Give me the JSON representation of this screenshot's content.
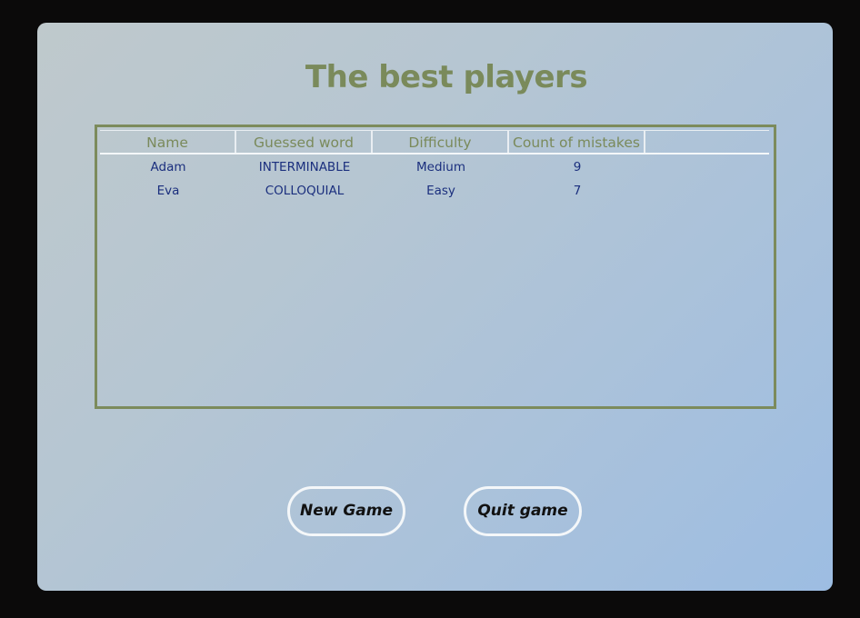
{
  "title": "The best players",
  "table": {
    "columns": [
      "Name",
      "Guessed word",
      "Difficulty",
      "Count of mistakes",
      ""
    ],
    "rows": [
      [
        "Adam",
        "INTERMINABLE",
        "Medium",
        "9"
      ],
      [
        "Eva",
        "COLLOQUIAL",
        "Easy",
        "7"
      ]
    ]
  },
  "buttons": {
    "new_game": "New Game",
    "quit_game": "Quit game"
  },
  "colors": {
    "title": "#7a8a5b",
    "table_border": "#7c8b5c",
    "cell_text": "#1b2f7e"
  }
}
